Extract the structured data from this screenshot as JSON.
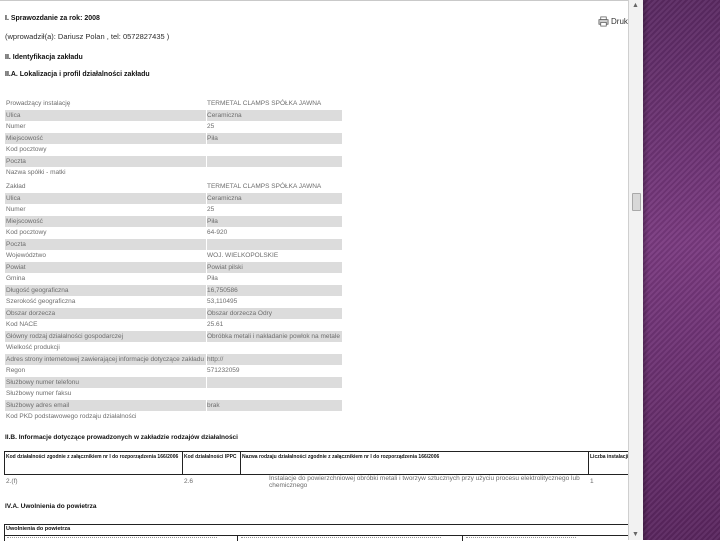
{
  "header": {
    "report_title": "I. Sprawozdanie za rok: 2008",
    "contact": "(wprowadził(a): Dariusz Polan , tel: 0572827435 )",
    "print_label": "Drukuj"
  },
  "section_ii": {
    "title": "II. Identyfikacja zakładu"
  },
  "section_iia": {
    "title": "II.A. Lokalizacja i profil działalności zakładu"
  },
  "operator_table": {
    "rows": [
      {
        "label": "Prowadzący instalację",
        "value": "TERMETAL CLAMPS SPÓŁKA JAWNA"
      },
      {
        "label": "Ulica",
        "value": "Ceramiczna"
      },
      {
        "label": "Numer",
        "value": "25"
      },
      {
        "label": "Miejscowość",
        "value": "Piła"
      },
      {
        "label": "Kod pocztowy",
        "value": ""
      },
      {
        "label": "Poczta",
        "value": ""
      },
      {
        "label": "Nazwa spółki - matki",
        "value": ""
      }
    ]
  },
  "facility_table": {
    "rows": [
      {
        "label": "Zakład",
        "value": "TERMETAL CLAMPS SPÓŁKA JAWNA"
      },
      {
        "label": "Ulica",
        "value": "Ceramiczna"
      },
      {
        "label": "Numer",
        "value": "25"
      },
      {
        "label": "Miejscowość",
        "value": "Piła"
      },
      {
        "label": "Kod pocztowy",
        "value": "64-920"
      },
      {
        "label": "Poczta",
        "value": ""
      },
      {
        "label": "Województwo",
        "value": "WOJ. WIELKOPOLSKIE"
      },
      {
        "label": "Powiat",
        "value": "Powiat pilski"
      },
      {
        "label": "Gmina",
        "value": "Piła"
      },
      {
        "label": "Długość geograficzna",
        "value": "16,750586"
      },
      {
        "label": "Szerokość geograficzna",
        "value": "53,110495"
      },
      {
        "label": "Obszar dorzecza",
        "value": "Obszar dorzecza Odry"
      },
      {
        "label": "Kod NACE",
        "value": "25.61"
      },
      {
        "label": "Główny rodzaj działalności gospodarczej",
        "value": "Obróbka metali i nakładanie powłok na metale"
      },
      {
        "label": "Wielkość produkcji",
        "value": ""
      },
      {
        "label": "Adres strony internetowej zawierającej informacje dotyczące zakładu",
        "value": "http://"
      },
      {
        "label": "Regon",
        "value": "571232059"
      },
      {
        "label": "Służbowy numer telefonu",
        "value": ""
      },
      {
        "label": "Służbowy numer faksu",
        "value": ""
      },
      {
        "label": "Służbowy adres email",
        "value": "brak"
      },
      {
        "label": "Kod PKD podstawowego rodzaju działalności",
        "value": ""
      }
    ]
  },
  "section_iib": {
    "title": "II.B. Informacje dotyczące prowadzonych w zakładzie rodzajów działalności",
    "headers": [
      "Kod działalności zgodnie z załącznikiem nr I do rozporządzenia 166/2006",
      "Kod działalności IPPC",
      "Nazwa rodzaju działalności zgodnie z załącznikiem nr I do rozporządzenia 166/2006",
      "Liczba instalacji"
    ],
    "row": {
      "code": "2.(f)",
      "ippc": "2.6",
      "name": "Instalacje do powierzchniowej obróbki metali i tworzyw sztucznych przy użyciu procesu elektrolitycznego lub chemicznego",
      "count": "1"
    }
  },
  "section_iva": {
    "title": "IV.A. Uwolnienia do powietrza",
    "box_label": "Uwolnienia do powietrza"
  }
}
